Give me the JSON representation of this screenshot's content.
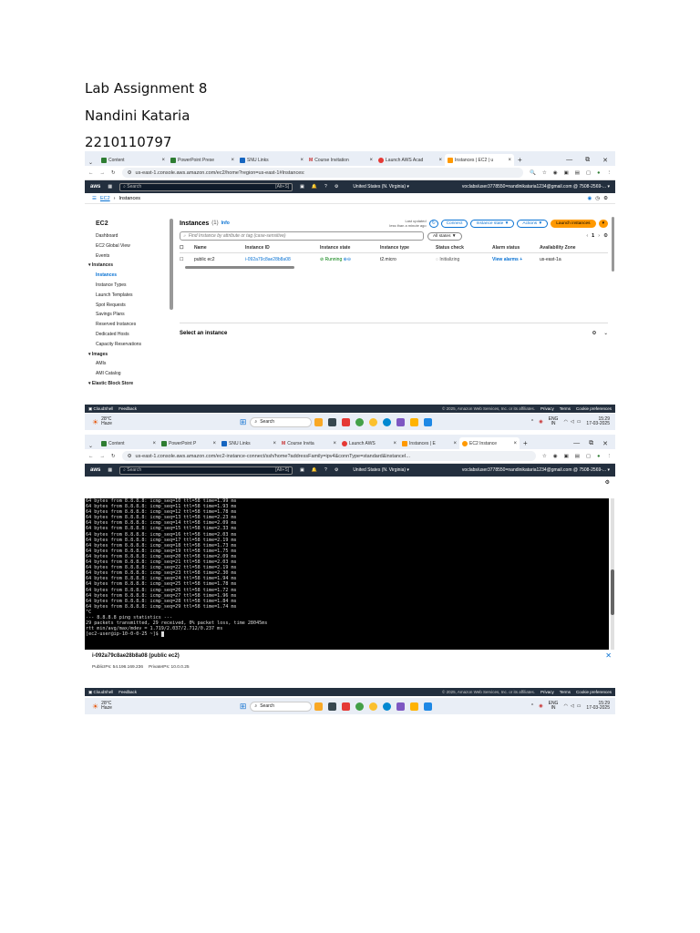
{
  "doc": {
    "title": "Lab Assignment 8",
    "name": "Nandini Kataria",
    "id": "2210110797"
  },
  "shot1": {
    "tabs": [
      "Content",
      "PowerPoint Prese",
      "SNU Links",
      "Course Invitation",
      "Launch AWS Acad",
      "Instances | EC2 | u"
    ],
    "url": "us-east-1.console.aws.amazon.com/ec2/home?region=us-east-1#Instances:",
    "aws_search": "Search",
    "aws_shortcut": "[Alt+S]",
    "region": "United States (N. Virginia) ▾",
    "account": "voclabs/user3778550=nandinikataria1234@gmail.com @ 7508-2569-... ▾",
    "crumb_root": "EC2",
    "crumb_page": "Instances",
    "sidebar": {
      "title": "EC2",
      "items": [
        "Dashboard",
        "EC2 Global View",
        "Events"
      ],
      "sec1": "Instances",
      "sec1_items": [
        "Instances",
        "Instance Types",
        "Launch Templates",
        "Spot Requests",
        "Savings Plans",
        "Reserved Instances",
        "Dedicated Hosts",
        "Capacity Reservations"
      ],
      "sec2": "Images",
      "sec2_items": [
        "AMIs",
        "AMI Catalog"
      ],
      "sec3": "Elastic Block Store"
    },
    "panel": {
      "title": "Instances",
      "count": "(1)",
      "info": "Info",
      "last_updated_l1": "Last updated",
      "last_updated_l2": "less than a minute ago",
      "connect": "Connect",
      "instance_state": "Instance state ▼",
      "actions": "Actions ▼",
      "launch": "Launch instances",
      "filter_placeholder": "Find Instance by attribute or tag (case-sensitive)",
      "all_states": "All states ▼",
      "page": "1",
      "columns": [
        "Name",
        "Instance ID",
        "Instance state",
        "Instance type",
        "Status check",
        "Alarm status",
        "Availability Zone"
      ],
      "row": {
        "name": "public ec2",
        "id": "i-092a79c8ae28b8a08",
        "state": "Running",
        "type": "t2.micro",
        "status": "Initializing",
        "alarm": "View alarms +",
        "az": "us-east-1a"
      },
      "select": "Select an instance"
    },
    "footer": {
      "cloudshell": "CloudShell",
      "feedback": "Feedback",
      "copyright": "© 2025, Amazon Web Services, Inc. or its affiliates.",
      "privacy": "Privacy",
      "terms": "Terms",
      "cookie": "Cookie preferences"
    },
    "taskbar": {
      "temp": "28°C",
      "weather": "Haze",
      "search": "Search",
      "lang": "ENG",
      "lang2": "IN",
      "time": "15:29",
      "date": "17-03-2025"
    }
  },
  "shot2": {
    "tabs": [
      "Content",
      "PowerPoint P",
      "SNU Links",
      "Course Invita",
      "Launch AWS",
      "Instances | E",
      "EC2 Instance"
    ],
    "url": "us-east-1.console.aws.amazon.com/ec2-instance-connect/ssh/home?addressFamily=ipv4&connType=standard&instanceI...",
    "terminal_lines": [
      "64 bytes from 8.8.8.8: icmp_seq=10 ttl=58 time=1.99 ms",
      "64 bytes from 8.8.8.8: icmp_seq=11 ttl=58 time=1.93 ms",
      "64 bytes from 8.8.8.8: icmp_seq=12 ttl=58 time=1.78 ms",
      "64 bytes from 8.8.8.8: icmp_seq=13 ttl=58 time=2.23 ms",
      "64 bytes from 8.8.8.8: icmp_seq=14 ttl=58 time=2.09 ms",
      "64 bytes from 8.8.8.8: icmp_seq=15 ttl=58 time=2.33 ms",
      "64 bytes from 8.8.8.8: icmp_seq=16 ttl=58 time=2.03 ms",
      "64 bytes from 8.8.8.8: icmp_seq=17 ttl=58 time=2.19 ms",
      "64 bytes from 8.8.8.8: icmp_seq=18 ttl=58 time=1.73 ms",
      "64 bytes from 8.8.8.8: icmp_seq=19 ttl=58 time=1.75 ms",
      "64 bytes from 8.8.8.8: icmp_seq=20 ttl=58 time=2.09 ms",
      "64 bytes from 8.8.8.8: icmp_seq=21 ttl=58 time=2.03 ms",
      "64 bytes from 8.8.8.8: icmp_seq=22 ttl=58 time=2.19 ms",
      "64 bytes from 8.8.8.8: icmp_seq=23 ttl=58 time=2.30 ms",
      "64 bytes from 8.8.8.8: icmp_seq=24 ttl=58 time=1.94 ms",
      "64 bytes from 8.8.8.8: icmp_seq=25 ttl=58 time=1.78 ms",
      "64 bytes from 8.8.8.8: icmp_seq=26 ttl=58 time=1.72 ms",
      "64 bytes from 8.8.8.8: icmp_seq=27 ttl=58 time=1.96 ms",
      "64 bytes from 8.8.8.8: icmp_seq=28 ttl=58 time=1.84 ms",
      "64 bytes from 8.8.8.8: icmp_seq=29 ttl=58 time=1.74 ms",
      "^C",
      "--- 8.8.8.8 ping statistics ---",
      "29 packets transmitted, 29 received, 0% packet loss, time 28045ms",
      "rtt min/avg/max/mdev = 1.719/2.037/2.712/0.237 ms",
      "[ec2-user@ip-10-0-0-25 ~]$ "
    ],
    "instance_title": "i-092a79c8ae28b8a08 (public ec2)",
    "public_ip_label": "PublicIPs: 54.196.169.236",
    "private_ip_label": "PrivateIPs: 10.0.0.25"
  }
}
